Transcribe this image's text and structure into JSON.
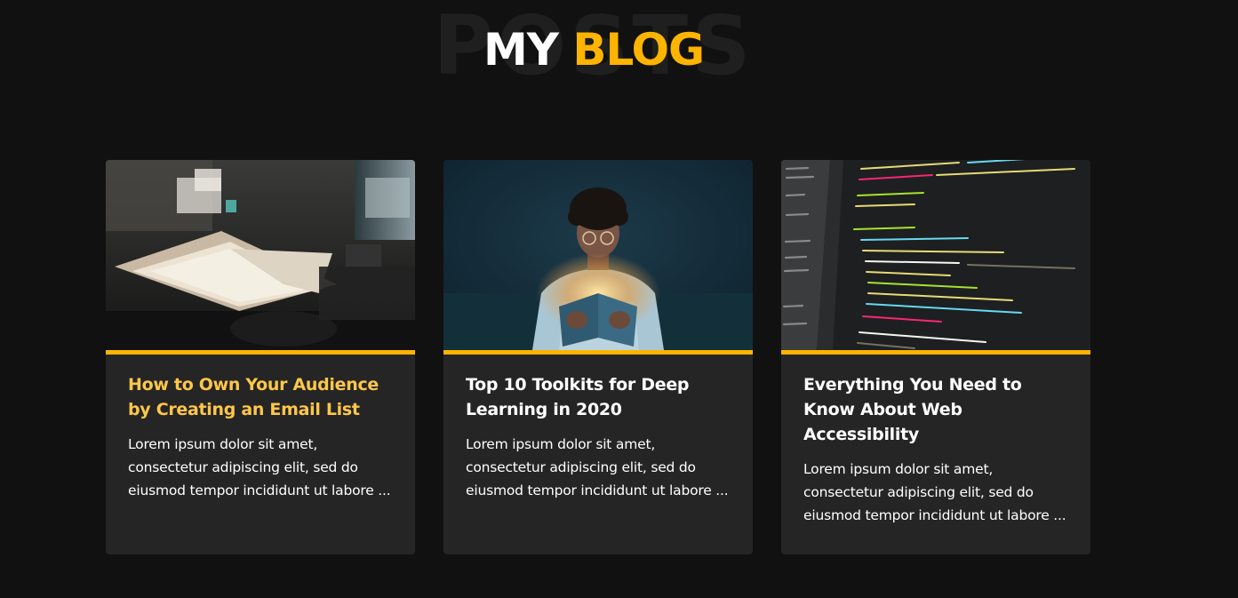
{
  "heading": {
    "background_word": "POSTS",
    "title_part1": "MY",
    "title_part2": "BLOG"
  },
  "colors": {
    "page_background": "#111111",
    "card_background": "#252525",
    "accent": "#ffb400",
    "active_title": "#ffc74a",
    "text": "#ffffff"
  },
  "posts": [
    {
      "title": "How to Own Your Audience by Creating an Email List",
      "excerpt": "Lorem ipsum dolor sit amet, consectetur adipiscing elit, sed do eiusmod tempor incididunt ut labore ...",
      "image": "desk-papers-photo",
      "active": true
    },
    {
      "title": "Top 10 Toolkits for Deep Learning in 2020",
      "excerpt": "Lorem ipsum dolor sit amet, consectetur adipiscing elit, sed do eiusmod tempor incididunt ut labore ...",
      "image": "person-reading-glowing-book-photo",
      "active": false
    },
    {
      "title": "Everything You Need to Know About Web Accessibility",
      "excerpt": "Lorem ipsum dolor sit amet, consectetur adipiscing elit, sed do eiusmod tempor incididunt ut labore ...",
      "image": "code-editor-screenshot-photo",
      "active": false
    }
  ]
}
